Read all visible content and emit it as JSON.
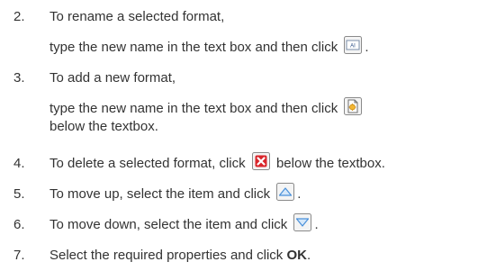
{
  "steps": [
    {
      "number": "2.",
      "line1": "To rename a selected format,",
      "line2_before": "type the new name in the text box and then click",
      "line2_after": ".",
      "icon": "rename-icon"
    },
    {
      "number": "3.",
      "line1": "To add a new format,",
      "line2_before": "type the new name in the text box and then click",
      "line3": "below the textbox.",
      "icon": "add-format-icon"
    },
    {
      "number": "4.",
      "before": "To delete a selected format, click",
      "after": "below the textbox.",
      "icon": "delete-icon"
    },
    {
      "number": "5.",
      "before": "To move up, select the item and click",
      "after": ".",
      "icon": "move-up-icon"
    },
    {
      "number": "6.",
      "before": "To move down, select the item and click",
      "after": ".",
      "icon": "move-down-icon"
    },
    {
      "number": "7.",
      "before": "Select the required properties and click",
      "bold": "OK",
      "after": ".",
      "icon": null
    }
  ],
  "colors": {
    "text": "#333333",
    "icon_border": "#8a8a8a",
    "delete_red": "#d9262c",
    "arrow_blue": "#4a90d9"
  }
}
